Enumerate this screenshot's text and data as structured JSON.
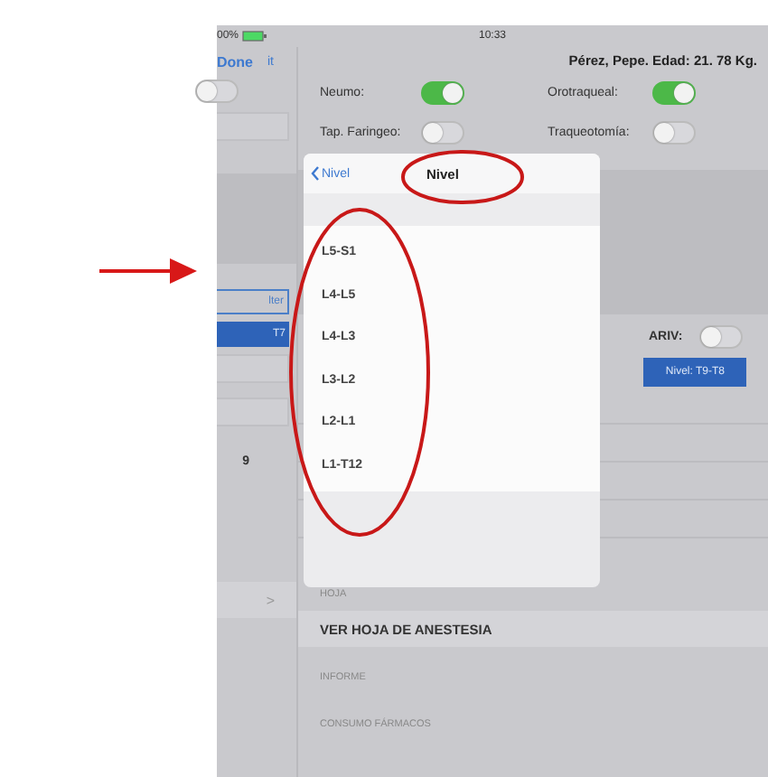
{
  "status_bar": {
    "battery": "00%",
    "time": "10:33"
  },
  "nav": {
    "done": "Done",
    "left_partial": "it",
    "patient": "Pérez, Pepe. Edad: 21. 78 Kg."
  },
  "toggles": [
    {
      "label": "Neumo:",
      "on": true
    },
    {
      "label": "Orotraqueal:",
      "on": true
    },
    {
      "label": "Tap. Faringeo:",
      "on": false
    },
    {
      "label": "Traqueotomía:",
      "on": false
    },
    {
      "label": "ARIV:",
      "on": false
    }
  ],
  "nivel_button": "Nivel: T9-T8",
  "left_pane": {
    "toggle_on": false,
    "outline_button": "lter",
    "blue_button": "T7",
    "value": "9",
    "chevron": ">"
  },
  "popover": {
    "back": "Nivel",
    "title": "Nivel",
    "items": [
      "L5-S1",
      "L4-L5",
      "L4-L3",
      "L3-L2",
      "L2-L1",
      "L1-T12"
    ]
  },
  "sections": [
    {
      "kind": "header",
      "text": "HOJA"
    },
    {
      "kind": "action",
      "text": "VER HOJA DE ANESTESIA"
    },
    {
      "kind": "header",
      "text": "INFORME"
    },
    {
      "kind": "header",
      "text": "CONSUMO FÁRMACOS"
    }
  ]
}
